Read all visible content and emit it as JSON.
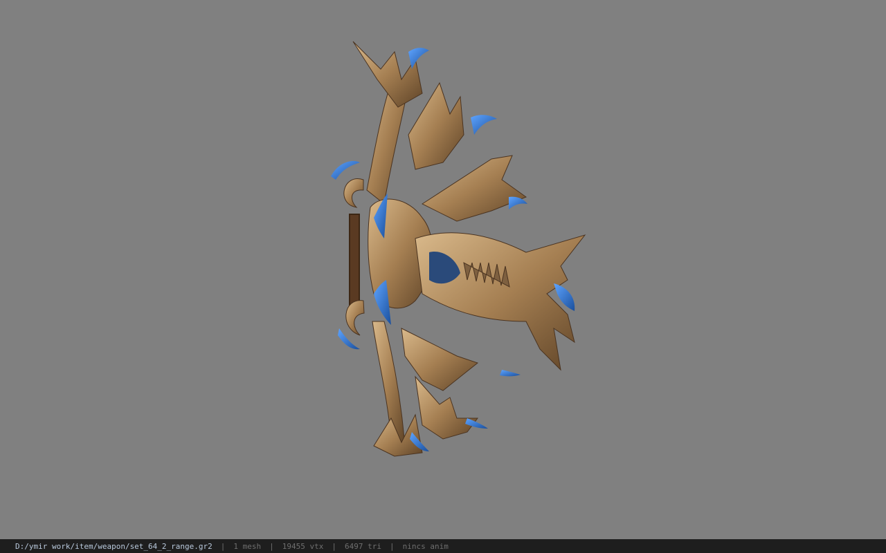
{
  "viewer": {
    "background_color": "#808080",
    "model_description": "bow-weapon-model"
  },
  "status_bar": {
    "file_path": "D:/ymir work/item/weapon/set_64_2_range.gr2",
    "separator": "|",
    "mesh_count": "1 mesh",
    "vertex_count": "19455 vtx",
    "triangle_count": "6497 tri",
    "anim_status": "nincs anim"
  },
  "colors": {
    "status_bg": "#1e1e1e",
    "path_text": "#b9c9dc",
    "info_text": "#6f6f6f",
    "model_gold": "#b08a5a",
    "model_blue": "#2f74c8"
  }
}
